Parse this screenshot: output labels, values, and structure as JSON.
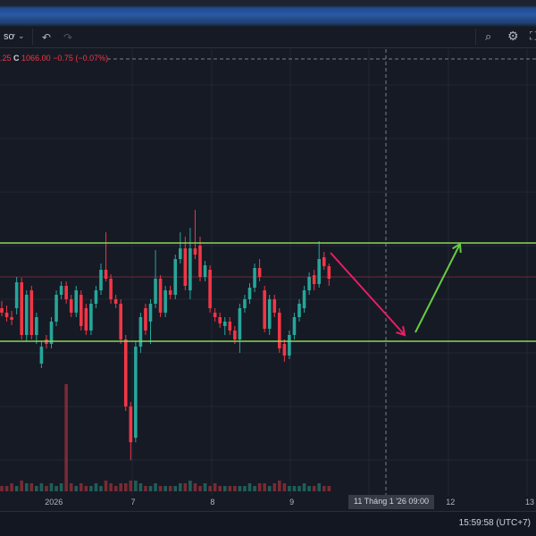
{
  "toolbar": {
    "interval_label": "sơ",
    "undo_icon": "undo-icon",
    "redo_icon": "redo-icon",
    "search_icon": "zoom-search-icon",
    "settings_icon": "gear-icon"
  },
  "legend": {
    "prev": ".25",
    "close_label": "C",
    "close": "1066.00",
    "change": "−0.75 (−0.07%)"
  },
  "colors": {
    "up": "#26a69a",
    "down": "#f23645",
    "level": "#8bd65a",
    "arrow_down": "#e91e63",
    "arrow_up": "#66cc44"
  },
  "chart_data": {
    "type": "candlestick",
    "levels": [
      1072.8,
      1061.8
    ],
    "current_price": 1069.0,
    "candles": [
      [
        1065.5,
        1066.3,
        1064.6,
        1065.0
      ],
      [
        1065.0,
        1065.8,
        1064.0,
        1064.5
      ],
      [
        1064.5,
        1065.2,
        1063.6,
        1064.2
      ],
      [
        1065.5,
        1069.0,
        1064.8,
        1068.4
      ],
      [
        1068.4,
        1068.9,
        1062.0,
        1062.5
      ],
      [
        1062.5,
        1067.5,
        1061.8,
        1067.0
      ],
      [
        1067.5,
        1068.0,
        1062.0,
        1062.5
      ],
      [
        1062.5,
        1065.0,
        1061.5,
        1064.5
      ],
      [
        1059.3,
        1061.8,
        1058.8,
        1061.2
      ],
      [
        1062.0,
        1062.5,
        1061.0,
        1061.5
      ],
      [
        1061.5,
        1064.5,
        1061.0,
        1064.0
      ],
      [
        1064.0,
        1067.5,
        1063.5,
        1067.0
      ],
      [
        1067.0,
        1068.5,
        1066.5,
        1068.0
      ],
      [
        1068.0,
        1068.5,
        1066.0,
        1066.5
      ],
      [
        1066.5,
        1067.0,
        1064.5,
        1065.0
      ],
      [
        1065.0,
        1068.0,
        1064.5,
        1067.5
      ],
      [
        1067.0,
        1067.5,
        1063.0,
        1063.5
      ],
      [
        1065.5,
        1066.0,
        1062.5,
        1063.0
      ],
      [
        1063.0,
        1066.5,
        1062.5,
        1066.0
      ],
      [
        1066.0,
        1068.0,
        1065.5,
        1067.5
      ],
      [
        1067.5,
        1070.5,
        1067.0,
        1069.8
      ],
      [
        1069.8,
        1074.0,
        1068.5,
        1068.8
      ],
      [
        1068.8,
        1069.3,
        1066.0,
        1066.5
      ],
      [
        1066.5,
        1067.0,
        1065.5,
        1066.0
      ],
      [
        1066.0,
        1066.5,
        1061.5,
        1062.0
      ],
      [
        1062.0,
        1062.5,
        1054.0,
        1054.5
      ],
      [
        1054.5,
        1055.0,
        1048.5,
        1050.5
      ],
      [
        1051.0,
        1061.8,
        1050.5,
        1061.2
      ],
      [
        1061.2,
        1065.0,
        1060.5,
        1064.5
      ],
      [
        1065.5,
        1066.0,
        1062.5,
        1063.0
      ],
      [
        1064.0,
        1066.5,
        1061.5,
        1066.0
      ],
      [
        1066.0,
        1072.0,
        1065.5,
        1068.8
      ],
      [
        1068.8,
        1069.2,
        1064.5,
        1065.0
      ],
      [
        1065.0,
        1068.0,
        1064.5,
        1067.5
      ],
      [
        1067.5,
        1068.0,
        1066.5,
        1067.0
      ],
      [
        1067.0,
        1071.5,
        1066.5,
        1071.0
      ],
      [
        1071.0,
        1074.0,
        1070.5,
        1072.2
      ],
      [
        1072.2,
        1073.5,
        1067.5,
        1068.0
      ],
      [
        1067.5,
        1074.5,
        1066.5,
        1072.2
      ],
      [
        1072.2,
        1076.5,
        1071.0,
        1071.5
      ],
      [
        1072.5,
        1073.5,
        1068.5,
        1069.0
      ],
      [
        1069.0,
        1070.8,
        1068.5,
        1070.3
      ],
      [
        1069.8,
        1070.3,
        1065.0,
        1065.5
      ],
      [
        1065.0,
        1065.5,
        1064.0,
        1064.5
      ],
      [
        1064.5,
        1065.0,
        1063.3,
        1063.8
      ],
      [
        1063.5,
        1064.5,
        1062.5,
        1064.0
      ],
      [
        1064.0,
        1064.5,
        1062.5,
        1063.0
      ],
      [
        1063.0,
        1063.5,
        1061.5,
        1062.0
      ],
      [
        1062.0,
        1066.0,
        1060.5,
        1065.5
      ],
      [
        1065.5,
        1067.0,
        1065.0,
        1066.5
      ],
      [
        1066.5,
        1068.3,
        1066.0,
        1067.8
      ],
      [
        1067.8,
        1070.5,
        1067.3,
        1070.0
      ],
      [
        1070.0,
        1071.0,
        1068.5,
        1069.0
      ],
      [
        1067.5,
        1068.0,
        1062.8,
        1063.2
      ],
      [
        1063.2,
        1067.0,
        1062.5,
        1066.5
      ],
      [
        1066.5,
        1067.0,
        1064.5,
        1065.0
      ],
      [
        1065.0,
        1065.5,
        1060.5,
        1061.0
      ],
      [
        1061.5,
        1062.0,
        1059.5,
        1060.2
      ],
      [
        1060.2,
        1063.0,
        1059.8,
        1062.5
      ],
      [
        1062.5,
        1065.0,
        1062.0,
        1064.5
      ],
      [
        1064.5,
        1066.5,
        1064.0,
        1066.0
      ],
      [
        1065.5,
        1068.0,
        1065.0,
        1067.5
      ],
      [
        1067.5,
        1069.5,
        1067.0,
        1069.0
      ],
      [
        1069.2,
        1069.8,
        1067.5,
        1068.2
      ],
      [
        1068.2,
        1073.0,
        1067.8,
        1071.0
      ],
      [
        1071.2,
        1071.8,
        1069.8,
        1070.2
      ],
      [
        1070.2,
        1070.5,
        1068.0,
        1068.8
      ]
    ],
    "volumes": [
      2,
      2,
      3,
      2,
      4,
      3,
      3,
      2,
      3,
      2,
      3,
      2,
      3,
      40,
      3,
      2,
      3,
      2,
      2,
      3,
      2,
      4,
      3,
      2,
      3,
      3,
      4,
      4,
      3,
      2,
      2,
      3,
      2,
      2,
      2,
      2,
      3,
      3,
      4,
      3,
      2,
      3,
      2,
      3,
      2,
      2,
      2,
      2,
      2,
      2,
      3,
      2,
      3,
      3,
      2,
      3,
      4,
      3,
      2,
      2,
      2,
      3,
      2,
      2,
      3,
      2,
      2
    ],
    "x_labels": [
      {
        "text": "2026",
        "pos": 10.5
      },
      {
        "text": "7",
        "pos": 26.5
      },
      {
        "text": "8",
        "pos": 42.5
      },
      {
        "text": "9",
        "pos": 58.5
      },
      {
        "text": "12",
        "pos": 90.5
      },
      {
        "text": "13",
        "pos": 106.5
      }
    ],
    "crosshair_label": "11 Tháng 1 '26   09:00"
  },
  "footer": {
    "time": "15:59:58 (UTC+7)"
  }
}
